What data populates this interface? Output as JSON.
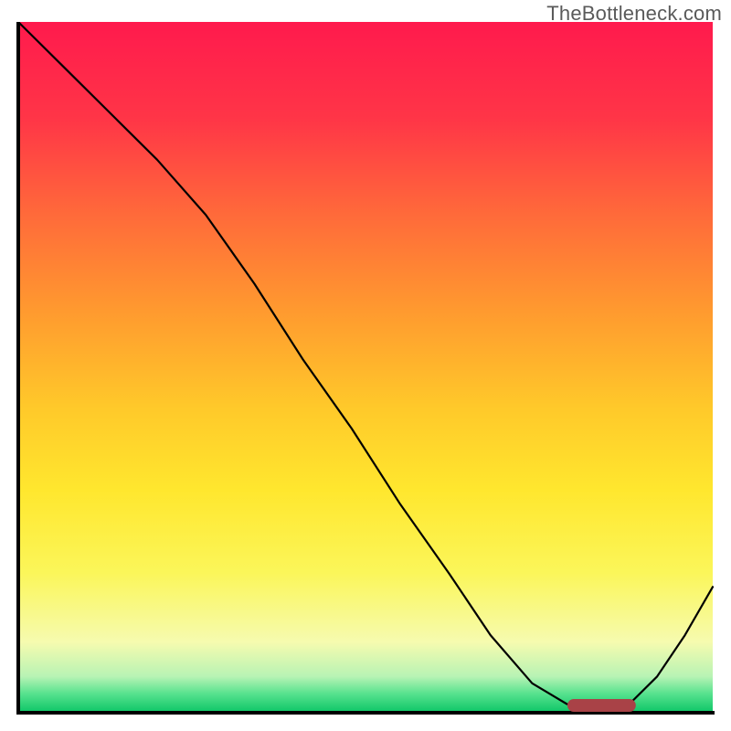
{
  "watermark": "TheBottleneck.com",
  "chart_data": {
    "type": "line",
    "title": "",
    "xlabel": "",
    "ylabel": "",
    "xlim": [
      0,
      100
    ],
    "ylim": [
      0,
      100
    ],
    "series": [
      {
        "name": "bottleneck_curve",
        "x": [
          0,
          6,
          13,
          20,
          27,
          34,
          41,
          48,
          55,
          62,
          68,
          74,
          79,
          82,
          85,
          88,
          92,
          96,
          100
        ],
        "y": [
          100,
          94,
          87,
          80,
          72,
          62,
          51,
          41,
          30,
          20,
          11,
          4,
          1,
          0,
          0,
          1,
          5,
          11,
          18
        ]
      }
    ],
    "marker": {
      "x_range": [
        80,
        88
      ],
      "y": 0.8,
      "color": "#ca5b63"
    },
    "gradient_stops": [
      {
        "offset": 0.0,
        "color": "#ff1a4d"
      },
      {
        "offset": 0.14,
        "color": "#ff3547"
      },
      {
        "offset": 0.28,
        "color": "#ff6a3a"
      },
      {
        "offset": 0.42,
        "color": "#ff9a2f"
      },
      {
        "offset": 0.56,
        "color": "#ffc92a"
      },
      {
        "offset": 0.68,
        "color": "#ffe72e"
      },
      {
        "offset": 0.8,
        "color": "#fbf65a"
      },
      {
        "offset": 0.9,
        "color": "#f6fbaf"
      },
      {
        "offset": 0.95,
        "color": "#b8f3b4"
      },
      {
        "offset": 0.975,
        "color": "#57e28e"
      },
      {
        "offset": 1.0,
        "color": "#13c86a"
      }
    ]
  }
}
